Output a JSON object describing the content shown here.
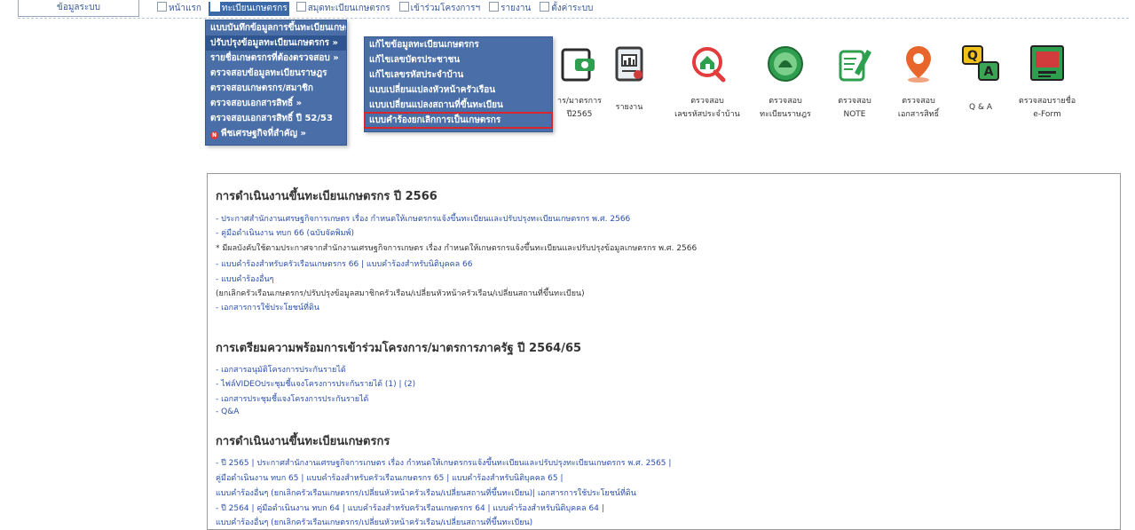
{
  "left_tab": "ข้อมูลระบบ",
  "topnav": [
    {
      "label": "หน้าแรก",
      "active": false
    },
    {
      "label": "ทะเบียนเกษตรกร",
      "active": true
    },
    {
      "label": "สมุดทะเบียนเกษตรกร",
      "active": false
    },
    {
      "label": "เข้าร่วมโครงการฯ",
      "active": false
    },
    {
      "label": "รายงาน",
      "active": false
    },
    {
      "label": "ตั้งค่าระบบ",
      "active": false
    }
  ],
  "menu_main": [
    "แบบบันทึกข้อมูลการขึ้นทะเบียนเกษตรกร »",
    "ปรับปรุงข้อมูลทะเบียนเกษตรกร »",
    "รายชื่อเกษตรกรที่ต้องตรวจสอบ »",
    "ตรวจสอบข้อมูลทะเบียนราษฎร",
    "ตรวจสอบเกษตรกร/สมาชิก",
    "ตรวจสอบเอกสารสิทธิ์ »",
    "ตรวจสอบเอกสารสิทธิ์ ปี 52/53",
    "พืชเศรษฐกิจที่สำคัญ »"
  ],
  "menu_sub": [
    "แก้ไขข้อมูลทะเบียนเกษตรกร",
    "แก้ไขเลขบัตรประชาชน",
    "แก้ไขเลขรหัสประจำบ้าน",
    "แบบเปลี่ยนแปลงหัวหน้าครัวเรือน",
    "แบบเปลี่ยนแปลงสถานที่ขึ้นทะเบียน",
    "แบบคำร้องยกเลิกการเป็นเกษตรกร"
  ],
  "icons": [
    {
      "name": "icon-project",
      "l1": "าร/มาตรการ",
      "l2": "ปี2565"
    },
    {
      "name": "icon-report",
      "l1": "รายงาน",
      "l2": ""
    },
    {
      "name": "icon-house-code",
      "l1": "ตรวจสอบ",
      "l2": "เลขรหัสประจำบ้าน"
    },
    {
      "name": "icon-civil-registry",
      "l1": "ตรวจสอบ",
      "l2": "ทะเบียนราษฎร"
    },
    {
      "name": "icon-note",
      "l1": "ตรวจสอบ",
      "l2": "NOTE"
    },
    {
      "name": "icon-land-deed",
      "l1": "ตรวจสอบ",
      "l2": "เอกสารสิทธิ์"
    },
    {
      "name": "icon-qa",
      "l1": "Q & A",
      "l2": ""
    },
    {
      "name": "icon-eform",
      "l1": "ตรวจสอบรายชื่อ",
      "l2": "e-Form"
    }
  ],
  "content": {
    "h1": "การดำเนินงานขึ้นทะเบียนเกษตรกร ปี 2566",
    "s1": [
      "- ประกาศสำนักงานเศรษฐกิจการเกษตร เรื่อง กำหนดให้เกษตรกรแจ้งขึ้นทะเบียนและปรับปรุงทะเบียนเกษตรกร พ.ศ. 2566",
      "- คู่มือดำเนินงาน ทบก 66 (ฉบับจัดพิมพ์)",
      "* มีผลบังคับใช้ตามประกาศจากสำนักงานเศรษฐกิจการเกษตร เรื่อง กำหนดให้เกษตรกรแจ้งขึ้นทะเบียนและปรับปรุงข้อมูลเกษตรกร พ.ศ. 2566",
      "- แบบคำร้องสำหรับครัวเรือนเกษตรกร 66 | แบบคำร้องสำหรับนิติบุคคล 66",
      "- แบบคำร้องอื่นๆ",
      "(ยกเลิกครัวเรือนเกษตรกร/ปรับปรุงข้อมูลสมาชิกครัวเรือน/เปลี่ยนหัวหน้าครัวเรือน/เปลี่ยนสถานที่ขึ้นทะเบียน)",
      "- เอกสารการใช้ประโยชน์ที่ดิน"
    ],
    "h2": "การเตรียมความพร้อมการเข้าร่วมโครงการ/มาตรการภาครัฐ ปี 2564/65",
    "s2": [
      "- เอกสารอนุมัติโครงการประกันรายได้",
      "- ไฟล์VIDEOประชุมชี้แจงโครงการประกันรายได้ (1) | (2)",
      "- เอกสารประชุมชี้แจงโครงการประกันรายได้",
      "- Q&A"
    ],
    "h3": "การดำเนินงานขึ้นทะเบียนเกษตรกร",
    "s3": [
      "- ปี 2565 | ประกาศสำนักงานเศรษฐกิจการเกษตร เรื่อง กำหนดให้เกษตรกรแจ้งขึ้นทะเบียนและปรับปรุงทะเบียนเกษตรกร พ.ศ. 2565 |",
      "คู่มือดำเนินงาน ทบก 65 | แบบคำร้องสำหรับครัวเรือนเกษตรกร 65 | แบบคำร้องสำหรับนิติบุคคล 65 |",
      "แบบคำร้องอื่นๆ (ยกเลิกครัวเรือนเกษตรกร/เปลี่ยนหัวหน้าครัวเรือน/เปลี่ยนสถานที่ขึ้นทะเบียน)| เอกสารการใช้ประโยชน์ที่ดิน",
      "- ปี 2564 | คู่มือดำเนินงาน ทบก 64 | แบบคำร้องสำหรับครัวเรือนเกษตรกร 64 | แบบคำร้องสำหรับนิติบุคคล 64 |",
      "แบบคำร้องอื่นๆ (ยกเลิกครัวเรือนเกษตรกร/เปลี่ยนหัวหน้าครัวเรือน/เปลี่ยนสถานที่ขึ้นทะเบียน)"
    ]
  }
}
